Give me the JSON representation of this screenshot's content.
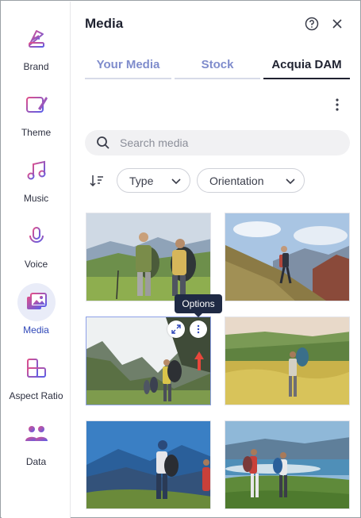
{
  "sidebar": {
    "items": [
      {
        "label": "Brand",
        "icon": "brand-palette-icon"
      },
      {
        "label": "Theme",
        "icon": "theme-icon"
      },
      {
        "label": "Music",
        "icon": "music-icon"
      },
      {
        "label": "Voice",
        "icon": "microphone-icon"
      },
      {
        "label": "Media",
        "icon": "media-icon",
        "active": true
      },
      {
        "label": "Aspect Ratio",
        "icon": "aspect-ratio-icon"
      },
      {
        "label": "Data",
        "icon": "data-users-icon"
      }
    ]
  },
  "panel": {
    "title": "Media",
    "tabs": [
      {
        "label": "Your Media"
      },
      {
        "label": "Stock"
      },
      {
        "label": "Acquia DAM",
        "active": true
      }
    ],
    "search": {
      "placeholder": "Search media",
      "value": ""
    },
    "filters": {
      "type": "Type",
      "orientation": "Orientation"
    },
    "tooltip": "Options"
  },
  "colors": {
    "accent": "#2f47b8",
    "icon_gradient_start": "#e04f8a",
    "icon_gradient_end": "#5b5ee8",
    "tooltip_bg": "#1f2a44",
    "annotation_arrow": "#e8473c"
  }
}
